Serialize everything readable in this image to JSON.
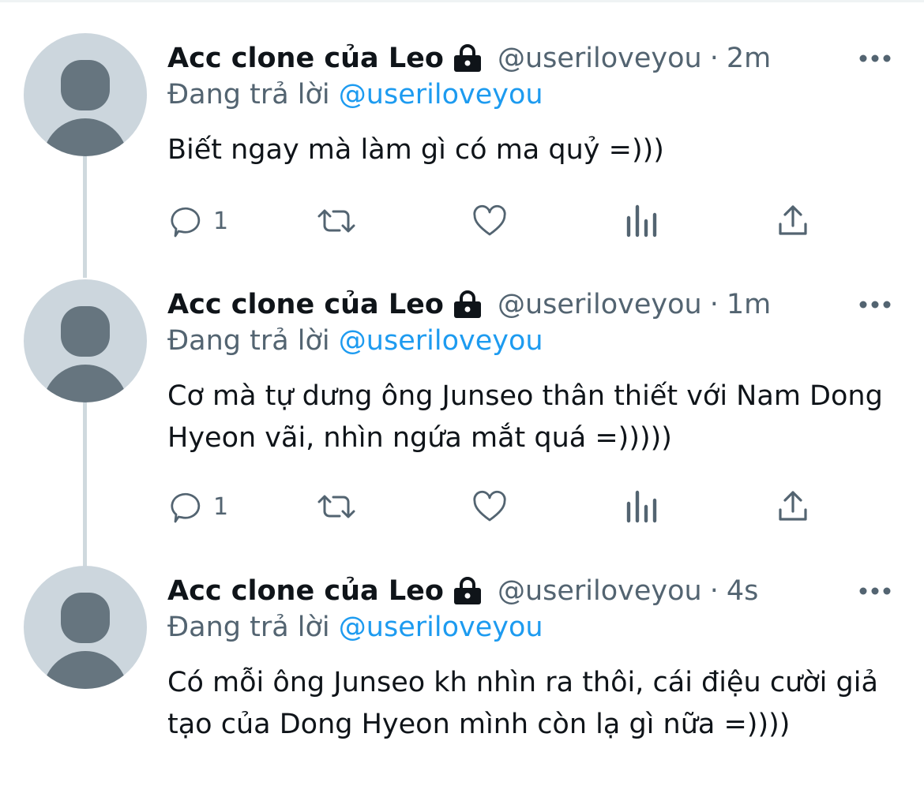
{
  "tweets": [
    {
      "name": "Acc clone của Leo",
      "handle": "@useriloveyou",
      "separator": "·",
      "time": "2m",
      "replying_prefix": "Đang trả lời",
      "replying_to": "@useriloveyou",
      "text": "Biết ngay mà làm gì có ma quỷ =)))",
      "reply_count": "1"
    },
    {
      "name": "Acc clone của Leo",
      "handle": "@useriloveyou",
      "separator": "·",
      "time": "1m",
      "replying_prefix": "Đang trả lời",
      "replying_to": "@useriloveyou",
      "text": "Cơ mà tự dưng ông Junseo thân thiết với Nam Dong Hyeon vãi, nhìn ngứa mắt quá =)))))",
      "reply_count": "1"
    },
    {
      "name": "Acc clone của Leo",
      "handle": "@useriloveyou",
      "separator": "·",
      "time": "4s",
      "replying_prefix": "Đang trả lời",
      "replying_to": "@useriloveyou",
      "text": "Có mỗi ông Junseo kh nhìn ra thôi, cái điệu cười giả tạo của Dong Hyeon mình còn lạ gì nữa =))))"
    }
  ],
  "icons": {
    "reply": "reply-icon",
    "retweet": "retweet-icon",
    "like": "heart-icon",
    "analytics": "analytics-icon",
    "share": "share-icon",
    "lock": "lock-icon",
    "more": "more-icon"
  },
  "colors": {
    "link": "#1d9bf0",
    "secondary_text": "#536471",
    "avatar_bg": "#ccd6dd",
    "avatar_fg": "#66757f",
    "thread_line": "#cfd9de"
  }
}
